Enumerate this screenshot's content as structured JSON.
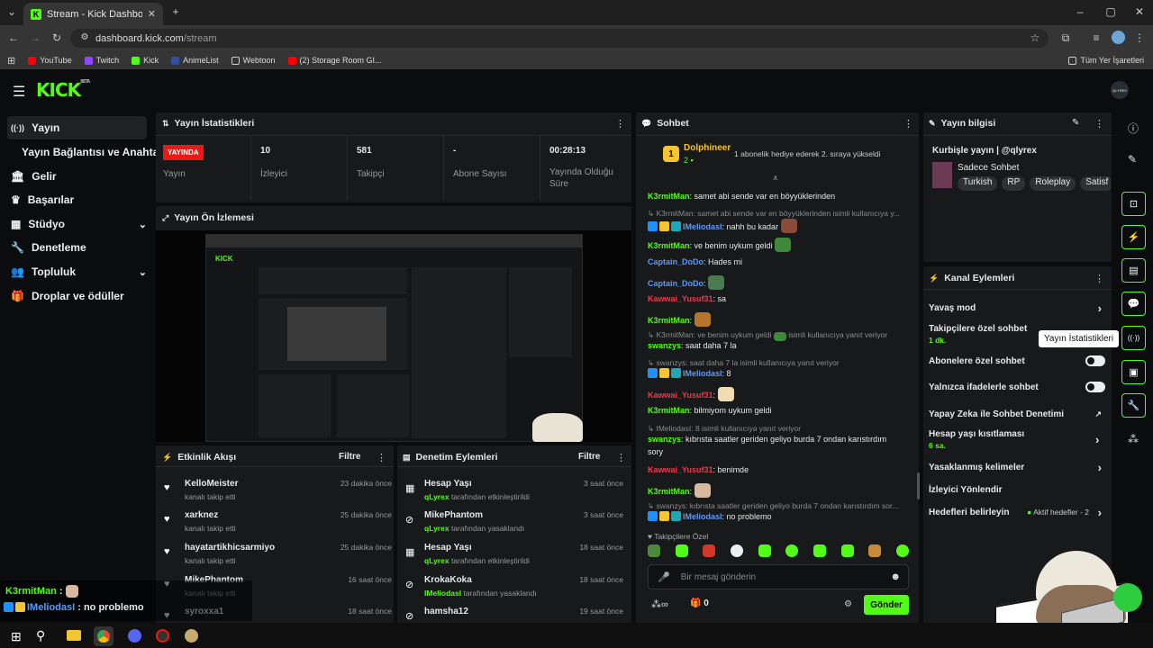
{
  "browser": {
    "tab_title": "Stream - Kick Dashboard",
    "url_domain": "dashboard.kick.com",
    "url_path": "/stream",
    "bookmarks": [
      "YouTube",
      "Twitch",
      "Kick",
      "AnimeList",
      "Webtoon",
      "(2) Storage Room GI..."
    ],
    "all_bookmarks": "Tüm Yer İşaretleri"
  },
  "header": {
    "logo": "KICK",
    "logo_sup": "BETA",
    "avatar": "QLYREX"
  },
  "sidebar": {
    "items": [
      {
        "label": "Yayın",
        "icon": "broadcast-icon"
      },
      {
        "label": "Yayın Bağlantısı ve Anahtarı"
      },
      {
        "label": "Gelir",
        "icon": "bank-icon"
      },
      {
        "label": "Başarılar",
        "icon": "trophy-icon"
      },
      {
        "label": "Stüdyo",
        "icon": "studio-icon"
      },
      {
        "label": "Denetleme",
        "icon": "wrench-icon"
      },
      {
        "label": "Topluluk",
        "icon": "community-icon"
      },
      {
        "label": "Droplar ve ödüller",
        "icon": "drops-icon"
      }
    ]
  },
  "stats": {
    "title": "Yayın İstatistikleri",
    "live": "YAYINDA",
    "live_label": "Yayın",
    "viewers": "10",
    "viewers_label": "İzleyici",
    "followers": "581",
    "followers_label": "Takipçi",
    "subs": "-",
    "subs_label": "Abone Sayısı",
    "uptime": "00:28:13",
    "uptime_label": "Yayında Olduğu Süre"
  },
  "preview": {
    "title": "Yayın Ön İzlemesi"
  },
  "activity": {
    "title": "Etkinlik Akışı",
    "filter": "Filtre",
    "items": [
      {
        "name": "KelloMeister",
        "sub": "kanalı takip etti",
        "time": "23 dakika önce"
      },
      {
        "name": "xarknez",
        "sub": "kanalı takip etti",
        "time": "25 dakika önce"
      },
      {
        "name": "hayatartikhicsarmiyo",
        "sub": "kanalı takip etti",
        "time": "25 dakika önce"
      },
      {
        "name": "MikePhantom",
        "sub": "kanalı takip etti",
        "time": "16 saat önce"
      },
      {
        "name": "syroxxa1",
        "sub": "",
        "time": "18 saat önce"
      }
    ]
  },
  "moderation": {
    "title": "Denetim Eylemleri",
    "filter": "Filtre",
    "items": [
      {
        "name": "Hesap Yaşı",
        "by": "qLyrex",
        "sub": "tarafından etkinleştirildi",
        "time": "3 saat önce"
      },
      {
        "name": "MikePhantom",
        "by": "qLyrex",
        "sub": "tarafından yasaklandı",
        "time": "3 saat önce"
      },
      {
        "name": "Hesap Yaşı",
        "by": "qLyrex",
        "sub": "tarafından etkinleştirildi",
        "time": "18 saat önce"
      },
      {
        "name": "KrokaKoka",
        "by": "IMeliodasI",
        "sub": "tarafından yasaklandı",
        "time": "18 saat önce"
      },
      {
        "name": "hamsha12",
        "by": "",
        "sub": "",
        "time": "19 saat önce"
      }
    ]
  },
  "chat": {
    "title": "Sohbet",
    "pinned_user": "Dolphineer",
    "pinned_count": "2",
    "pinned_text": "1 abonelik hediye ederek 2. sıraya yükseldi",
    "followers_only": "Takipçilere Özel",
    "placeholder": "Bir mesaj gönderin",
    "points": "0",
    "send": "Gönder",
    "messages": [
      {
        "reply": "",
        "user": "K3rmitMan",
        "color": "g",
        "text": ": samet abi sende var en böyyüklerinden"
      },
      {
        "reply": "K3rmitMan: samet abi sende var en böyyüklerinden isimli kullanıcıya y...",
        "user": "IMeliodasI",
        "color": "b",
        "text": ": nahh bu kadar"
      },
      {
        "reply": "",
        "user": "K3rmitMan",
        "color": "g",
        "text": ": ve benim uykum geldi"
      },
      {
        "reply": "",
        "user": "Captain_DoDo",
        "color": "b",
        "text": ": Hades mi"
      },
      {
        "reply": "",
        "user": "Captain_DoDo",
        "color": "b",
        "text": ":"
      },
      {
        "reply": "",
        "user": "Kawwai_Yusuf31",
        "color": "r",
        "text": ": sa"
      },
      {
        "reply": "",
        "user": "K3rmitMan",
        "color": "g",
        "text": ":"
      },
      {
        "reply": "K3rmitMan: ve benim uykum geldi",
        "reply2": "isimli kullanıcıya yanıt veriyor",
        "user": "swanzys",
        "color": "g",
        "text": ": saat daha 7 la"
      },
      {
        "reply": "swanzys: saat daha 7 la isimli kullanıcıya yanıt veriyor",
        "user": "IMeliodasI",
        "color": "b",
        "text": ": 8"
      },
      {
        "reply": "",
        "user": "Kawwai_Yusuf31",
        "color": "r",
        "text": ":"
      },
      {
        "reply": "",
        "user": "K3rmitMan",
        "color": "g",
        "text": ": bilmiyom uykum geldi"
      },
      {
        "reply": "IMeliodasI: 8 isimli kullanıcıya yanıt veriyor",
        "user": "swanzys",
        "color": "g",
        "text": ": kıbrısta saatler geriden geliyo burda 7 ondan karıstırdım"
      },
      {
        "reply": "",
        "user": "",
        "color": "",
        "text": "sory"
      },
      {
        "reply": "",
        "user": "Kawwai_Yusuf31",
        "color": "r",
        "text": ": benimde"
      },
      {
        "reply": "",
        "user": "K3rmitMan",
        "color": "g",
        "text": ":"
      },
      {
        "reply": "swanzys: kıbrısta saatler geriden geliyo burda 7 ondan karıstırdım sor...",
        "user": "IMeliodasI",
        "color": "b",
        "text": ": no problemo"
      }
    ]
  },
  "info": {
    "title": "Yayın bilgisi",
    "stream_title": "Kurbişle yayın | @qlyrex",
    "category": "Sadece Sohbet",
    "tags": [
      "Turkish",
      "RP",
      "Roleplay",
      "Satisf"
    ]
  },
  "channel_actions": {
    "title": "Kanal Eylemleri",
    "items": [
      {
        "label": "Yavaş mod",
        "sub": "",
        "type": "chevron"
      },
      {
        "label": "Takipçilere özel sohbet",
        "sub": "1 dk.",
        "type": "toggle-on"
      },
      {
        "label": "Abonelere özel sohbet",
        "sub": "",
        "type": "toggle"
      },
      {
        "label": "Yalnızca ifadelerle sohbet",
        "sub": "",
        "type": "toggle"
      },
      {
        "label": "Yapay Zeka ile Sohbet Denetimi",
        "sub": "",
        "type": "external"
      },
      {
        "label": "Hesap yaşı kısıtlaması",
        "sub": "6 sa.",
        "type": "chevron"
      },
      {
        "label": "Yasaklanmış kelimeler",
        "sub": "",
        "type": "chevron"
      },
      {
        "label": "İzleyici Yönlendir",
        "sub": "",
        "type": "none"
      },
      {
        "label": "Hedefleri belirleyin",
        "sub": "Aktif hedefler - 2",
        "type": "chevron"
      }
    ]
  },
  "tooltip": "Yayın İstatistikleri",
  "overlay": {
    "line1_user": "K3rmitMan",
    "line1_text": " :",
    "line2_user": "IMeliodasI",
    "line2_text": " : no problemo"
  },
  "colors": {
    "accent": "#53fc18",
    "panel": "#18191b",
    "bg": "#0b0c0e",
    "live": "#e91916"
  }
}
